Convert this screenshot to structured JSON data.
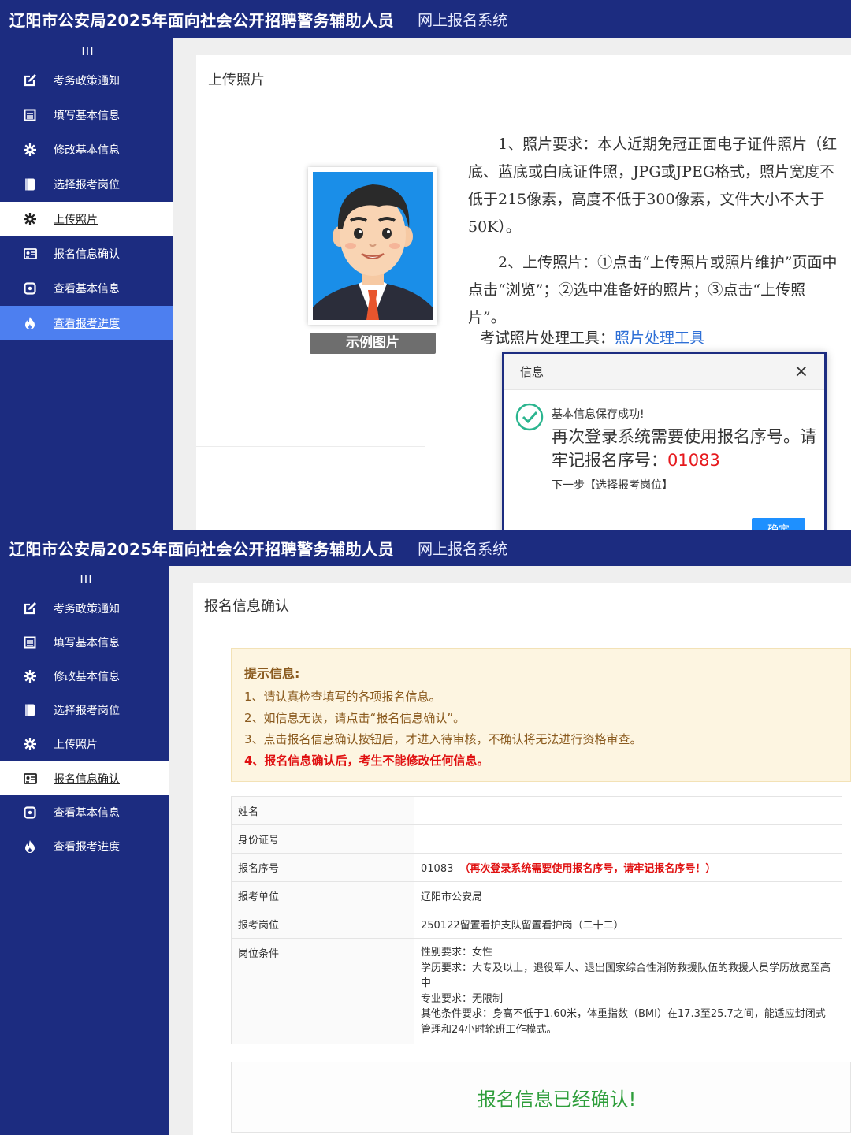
{
  "screen1": {
    "header": {
      "title": "辽阳市公安局2025年面向社会公开招聘警务辅助人员",
      "subtitle": "网上报名系统"
    },
    "sidebar": {
      "toggle": "III",
      "items": [
        {
          "label": "考务政策通知",
          "icon": "edit-icon"
        },
        {
          "label": "填写基本信息",
          "icon": "form-icon"
        },
        {
          "label": "修改基本信息",
          "icon": "gear-icon"
        },
        {
          "label": "选择报考岗位",
          "icon": "bookmark-icon"
        },
        {
          "label": "上传照片",
          "icon": "gear-icon",
          "state": "active"
        },
        {
          "label": "报名信息确认",
          "icon": "id-card-icon"
        },
        {
          "label": "查看基本信息",
          "icon": "eye-icon"
        },
        {
          "label": "查看报考进度",
          "icon": "fire-icon",
          "state": "hover"
        }
      ]
    },
    "panel": {
      "title": "上传照片",
      "sample_label": "示例图片",
      "req1": "1、照片要求：本人近期免冠正面电子证件照片（红底、蓝底或白底证件照，JPG或JPEG格式，照片宽度不低于215像素，高度不低于300像素，文件大小不大于50K）。",
      "req2": "2、上传照片：①点击“上传照片或照片维护”页面中点击“浏览”；②选中准备好的照片；③点击“上传照片”。",
      "tool_prefix": "考试照片处理工具：",
      "tool_link": "照片处理工具"
    },
    "dialog": {
      "title": "信息",
      "close": "×",
      "line1": "基本信息保存成功!",
      "line2a": "再次登录系统需要使用报名序号。请牢记报名序号：",
      "reg_no": "01083",
      "line3": "下一步【选择报考岗位】",
      "ok": "确定"
    }
  },
  "screen2": {
    "header": {
      "title": "辽阳市公安局2025年面向社会公开招聘警务辅助人员",
      "subtitle": "网上报名系统"
    },
    "sidebar": {
      "toggle": "III",
      "items": [
        {
          "label": "考务政策通知",
          "icon": "edit-icon"
        },
        {
          "label": "填写基本信息",
          "icon": "form-icon"
        },
        {
          "label": "修改基本信息",
          "icon": "gear-icon"
        },
        {
          "label": "选择报考岗位",
          "icon": "bookmark-icon"
        },
        {
          "label": "上传照片",
          "icon": "gear-icon"
        },
        {
          "label": "报名信息确认",
          "icon": "id-card-icon",
          "state": "active"
        },
        {
          "label": "查看基本信息",
          "icon": "eye-icon"
        },
        {
          "label": "查看报考进度",
          "icon": "fire-icon"
        }
      ]
    },
    "panel": {
      "title": "报名信息确认",
      "notice": {
        "title": "提示信息:",
        "line1": "1、请认真检查填写的各项报名信息。",
        "line2": "2、如信息无误，请点击“报名信息确认”。",
        "line3": "3、点击报名信息确认按钮后，才进入待审核，不确认将无法进行资格审查。",
        "line4": "4、报名信息确认后，考生不能修改任何信息。"
      },
      "table": {
        "name_label": "姓名",
        "name_value": "",
        "id_label": "身份证号",
        "id_value": "",
        "regno_label": "报名序号",
        "regno_value": "01083",
        "regno_warn": "（再次登录系统需要使用报名序号，请牢记报名序号！）",
        "unit_label": "报考单位",
        "unit_value": "辽阳市公安局",
        "post_label": "报考岗位",
        "post_value": "250122留置看护支队留置看护岗（二十二）",
        "cond_label": "岗位条件",
        "cond_gender": "性别要求：女性",
        "cond_edu": "学历要求：大专及以上，退役军人、退出国家综合性消防救援队伍的救援人员学历放宽至高中",
        "cond_major": "专业要求：无限制",
        "cond_other": "其他条件要求：身高不低于1.60米，体重指数（BMI）在17.3至25.7之间，能适应封闭式管理和24小时轮班工作模式。"
      },
      "confirmed": "报名信息已经确认!"
    }
  }
}
